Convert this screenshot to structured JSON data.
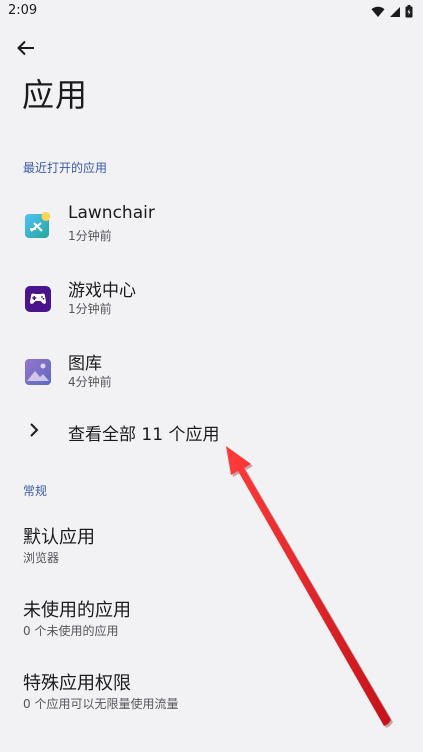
{
  "status_bar": {
    "time": "2:09"
  },
  "header": {
    "title": "应用"
  },
  "recent": {
    "section_label": "最近打开的应用",
    "apps": [
      {
        "name": "Lawnchair",
        "subtitle": "1分钟前",
        "icon": "lawnchair-app-icon"
      },
      {
        "name": "游戏中心",
        "subtitle": "1分钟前",
        "icon": "game-center-app-icon"
      },
      {
        "name": "图库",
        "subtitle": "4分钟前",
        "icon": "gallery-app-icon"
      }
    ],
    "see_all_label": "查看全部 11 个应用"
  },
  "general": {
    "section_label": "常规",
    "items": [
      {
        "title": "默认应用",
        "subtitle": "浏览器"
      },
      {
        "title": "未使用的应用",
        "subtitle": "0 个未使用的应用"
      },
      {
        "title": "特殊应用权限",
        "subtitle": "0 个应用可以无限量使用流量"
      }
    ]
  },
  "colors": {
    "accent": "#3a5ba8",
    "annotation": "#e8202a",
    "background": "#f2f2f4"
  }
}
